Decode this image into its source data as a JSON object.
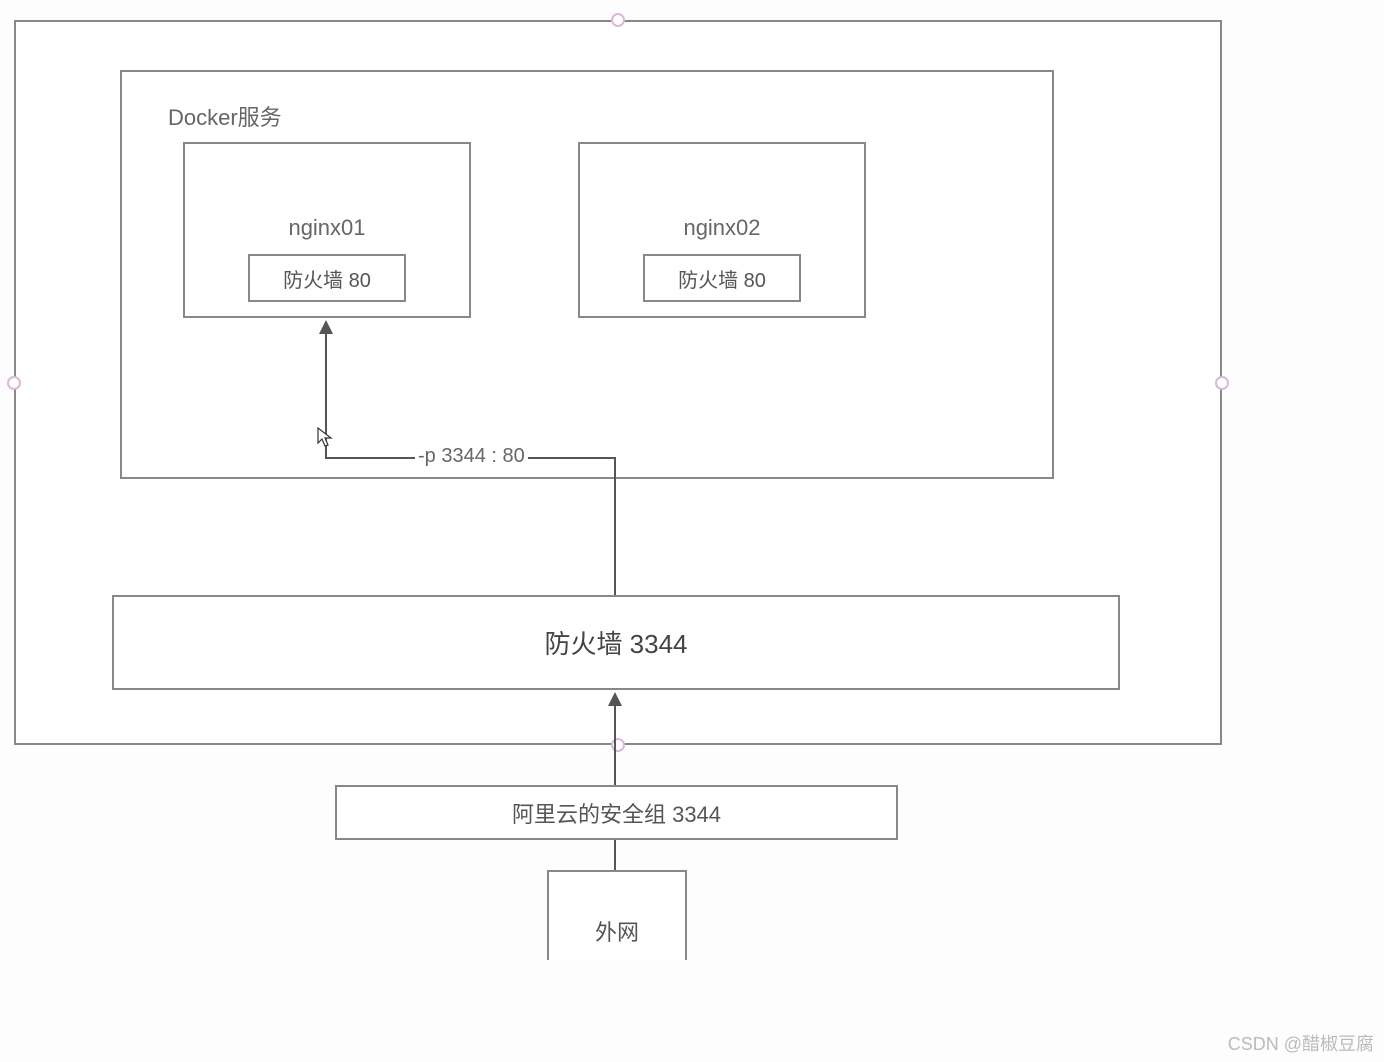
{
  "docker_label": "Docker服务",
  "nginx01": {
    "title": "nginx01",
    "firewall": "防火墙  80"
  },
  "nginx02": {
    "title": "nginx02",
    "firewall": "防火墙  80"
  },
  "port_mapping": "-p 3344 : 80",
  "firewall_main": "防火墙   3344",
  "security_group": "阿里云的安全组   3344",
  "external_net": "外网",
  "watermark": "CSDN @醋椒豆腐"
}
